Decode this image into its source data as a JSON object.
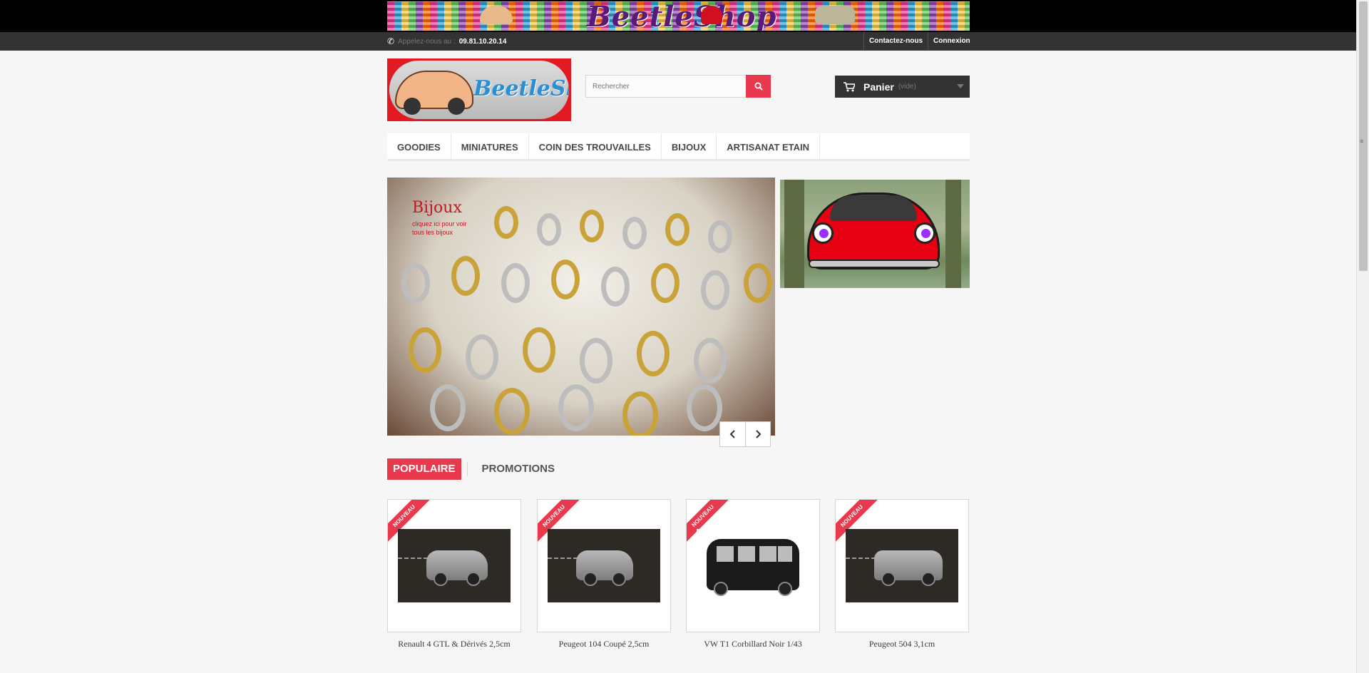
{
  "top_banner": {
    "title": "BeetleShop"
  },
  "header_bar": {
    "phone_label": "Appelez-nous au :",
    "phone_number": "09.81.10.20.14",
    "links": [
      "Contactez-nous",
      "Connexion"
    ]
  },
  "logo": {
    "text": "BeetleShop"
  },
  "search": {
    "placeholder": "Rechercher"
  },
  "cart": {
    "label": "Panier",
    "status": "(vide)"
  },
  "menu": {
    "items": [
      "GOODIES",
      "MINIATURES",
      "COIN DES TROUVAILLES",
      "BIJOUX",
      "ARTISANAT ETAIN"
    ]
  },
  "slider": {
    "title": "Bijoux",
    "text": "cliquez ici pour voir tous les bijoux"
  },
  "tabs": {
    "items": [
      "POPULAIRE",
      "PROMOTIONS"
    ],
    "active": "POPULAIRE"
  },
  "products": [
    {
      "ribbon": "NOUVEAU",
      "name": "Renault 4 GTL & Dérivés 2,5cm"
    },
    {
      "ribbon": "NOUVEAU",
      "name": "Peugeot 104 Coupé 2,5cm"
    },
    {
      "ribbon": "NOUVEAU",
      "name": "VW T1 Corbillard Noir 1/43"
    },
    {
      "ribbon": "NOUVEAU",
      "name": "Peugeot 504 3,1cm"
    }
  ],
  "colors": {
    "accent": "#e8394d",
    "dark_bar": "#333333",
    "logo_red": "#e21b23"
  }
}
